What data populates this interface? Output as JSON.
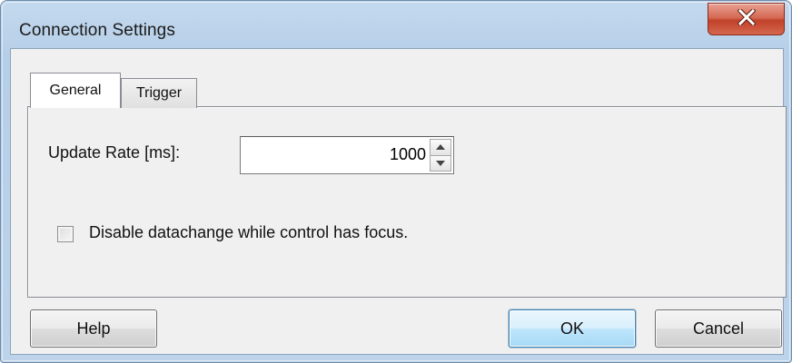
{
  "window": {
    "title": "Connection Settings",
    "close_icon": "close-icon"
  },
  "tabs": [
    {
      "label": "General",
      "selected": true
    },
    {
      "label": "Trigger",
      "selected": false
    }
  ],
  "general": {
    "update_rate_label": "Update Rate [ms]:",
    "update_rate_value": "1000",
    "disable_datachange_label": "Disable datachange while control has focus.",
    "disable_datachange_checked": false
  },
  "buttons": {
    "help": "Help",
    "ok": "OK",
    "cancel": "Cancel"
  },
  "colors": {
    "title_bar": "#bcd3ea",
    "close_button": "#c2412a",
    "default_button_border": "#3c7fb1"
  }
}
